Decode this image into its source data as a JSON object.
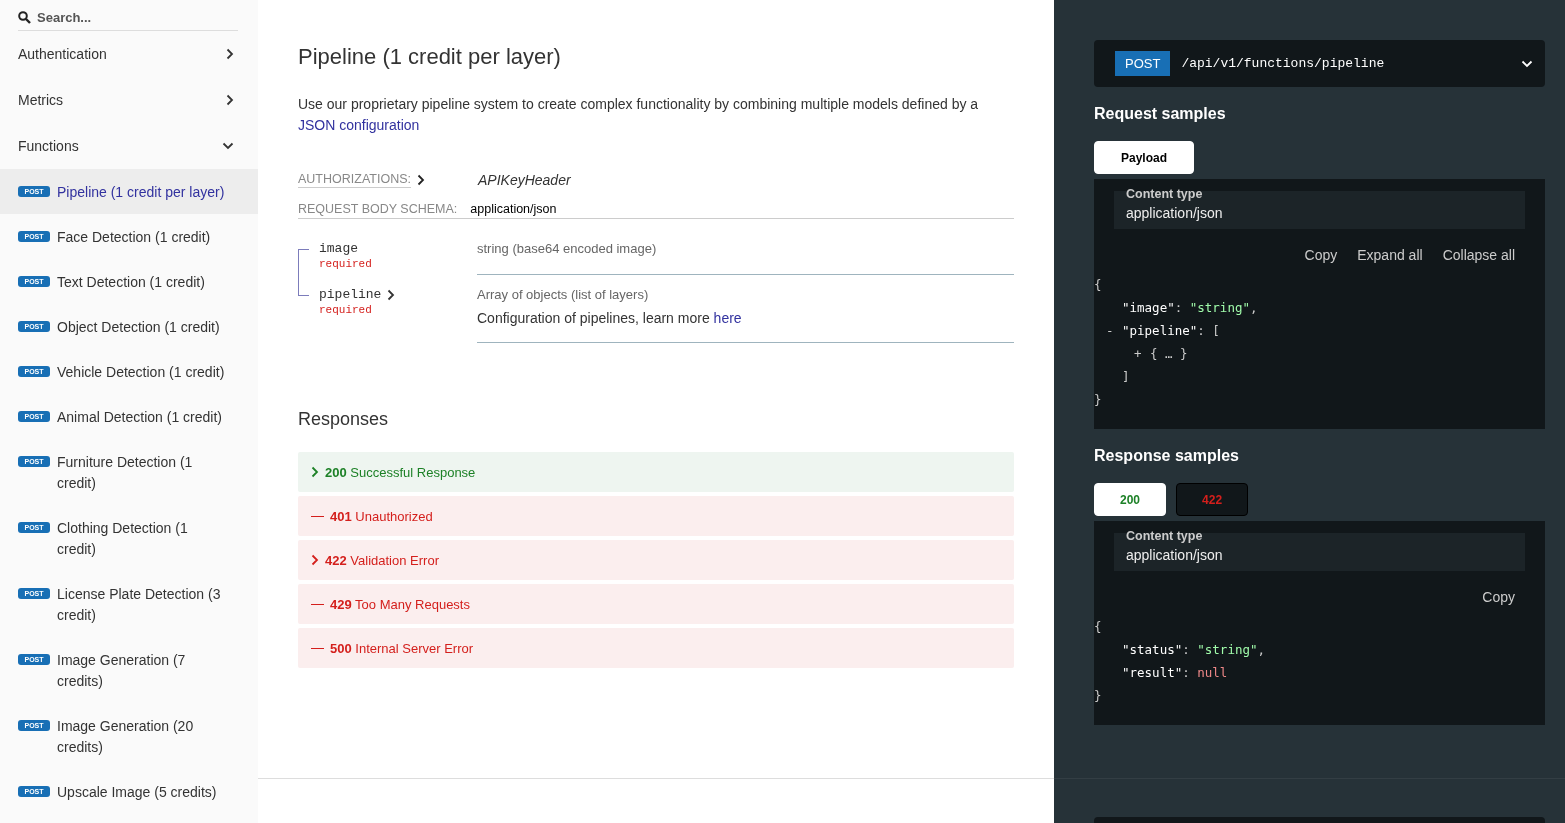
{
  "sidebar": {
    "search": {
      "placeholder": "Search..."
    },
    "groups": [
      {
        "label": "Authentication",
        "expanded": false
      },
      {
        "label": "Metrics",
        "expanded": false
      },
      {
        "label": "Functions",
        "expanded": true,
        "items": [
          {
            "method": "POST",
            "label": "Pipeline (1 credit per layer)",
            "selected": true
          },
          {
            "method": "POST",
            "label": "Face Detection (1 credit)",
            "selected": false
          },
          {
            "method": "POST",
            "label": "Text Detection (1 credit)",
            "selected": false
          },
          {
            "method": "POST",
            "label": "Object Detection (1 credit)",
            "selected": false
          },
          {
            "method": "POST",
            "label": "Vehicle Detection (1 credit)",
            "selected": false
          },
          {
            "method": "POST",
            "label": "Animal Detection (1 credit)",
            "selected": false
          },
          {
            "method": "POST",
            "label": "Furniture Detection (1 credit)",
            "selected": false
          },
          {
            "method": "POST",
            "label": "Clothing Detection (1 credit)",
            "selected": false
          },
          {
            "method": "POST",
            "label": "License Plate Detection (3 credit)",
            "selected": false
          },
          {
            "method": "POST",
            "label": "Image Generation (7 credits)",
            "selected": false
          },
          {
            "method": "POST",
            "label": "Image Generation (20 credits)",
            "selected": false
          },
          {
            "method": "POST",
            "label": "Upscale Image (5 credits)",
            "selected": false
          }
        ]
      }
    ]
  },
  "operation": {
    "title": "Pipeline (1 credit per layer)",
    "description": "Use our proprietary pipeline system to create complex functionality by combining multiple models defined by a",
    "description_link": "JSON configuration",
    "authorizations": {
      "label": "AUTHORIZATIONS:",
      "value": "APIKeyHeader"
    },
    "request_body": {
      "label": "REQUEST BODY SCHEMA:",
      "value": "application/json"
    },
    "fields": [
      {
        "name": "image",
        "expandable": false,
        "required": "required",
        "type": "string (base64 encoded image)"
      },
      {
        "name": "pipeline",
        "expandable": true,
        "required": "required",
        "type": "Array of objects (list of layers)",
        "description": "Configuration of pipelines, learn more",
        "link": "here"
      }
    ],
    "responses_title": "Responses",
    "responses": [
      {
        "code": "200",
        "text": "Successful Response",
        "kind": "success",
        "expandable": true
      },
      {
        "code": "401",
        "text": "Unauthorized",
        "kind": "error",
        "expandable": false
      },
      {
        "code": "422",
        "text": "Validation Error",
        "kind": "error",
        "expandable": true
      },
      {
        "code": "429",
        "text": "Too Many Requests",
        "kind": "error",
        "expandable": false
      },
      {
        "code": "500",
        "text": "Internal Server Error",
        "kind": "error",
        "expandable": false
      }
    ]
  },
  "samples": {
    "endpoint": {
      "method": "POST",
      "path": "/api/v1/functions/pipeline"
    },
    "request": {
      "title": "Request samples",
      "tabs": [
        {
          "label": "Payload",
          "selected": true,
          "kind": "neutral"
        }
      ],
      "content_type_label": "Content type",
      "content_type": "application/json",
      "actions": [
        "Copy",
        "Expand all",
        "Collapse all"
      ],
      "code": {
        "open": [
          {
            "kind": "punct",
            "text": "{"
          }
        ],
        "close": [
          {
            "kind": "punct",
            "text": "}"
          }
        ],
        "children": [
          {
            "open": [
              {
                "kind": "key",
                "text": "\"image\""
              },
              {
                "kind": "punct",
                "text": ": "
              },
              {
                "kind": "string",
                "text": "\"string\""
              },
              {
                "kind": "punct",
                "text": ","
              }
            ]
          },
          {
            "toggle": "-",
            "open": [
              {
                "kind": "key",
                "text": "\"pipeline\""
              },
              {
                "kind": "punct",
                "text": ": ["
              }
            ],
            "close": [
              {
                "kind": "punct",
                "text": "]"
              }
            ],
            "children": [
              {
                "toggle": "+",
                "open": [
                  {
                    "kind": "punct",
                    "text": "{ … }"
                  }
                ]
              }
            ]
          }
        ]
      }
    },
    "response": {
      "title": "Response samples",
      "tabs": [
        {
          "label": "200",
          "selected": true,
          "kind": "success"
        },
        {
          "label": "422",
          "selected": false,
          "kind": "error"
        }
      ],
      "content_type_label": "Content type",
      "content_type": "application/json",
      "actions": [
        "Copy"
      ],
      "code": {
        "open": [
          {
            "kind": "punct",
            "text": "{"
          }
        ],
        "close": [
          {
            "kind": "punct",
            "text": "}"
          }
        ],
        "children": [
          {
            "open": [
              {
                "kind": "key",
                "text": "\"status\""
              },
              {
                "kind": "punct",
                "text": ": "
              },
              {
                "kind": "string",
                "text": "\"string\""
              },
              {
                "kind": "punct",
                "text": ","
              }
            ]
          },
          {
            "open": [
              {
                "kind": "key",
                "text": "\"result\""
              },
              {
                "kind": "punct",
                "text": ": "
              },
              {
                "kind": "null",
                "text": "null"
              }
            ]
          }
        ]
      }
    }
  }
}
